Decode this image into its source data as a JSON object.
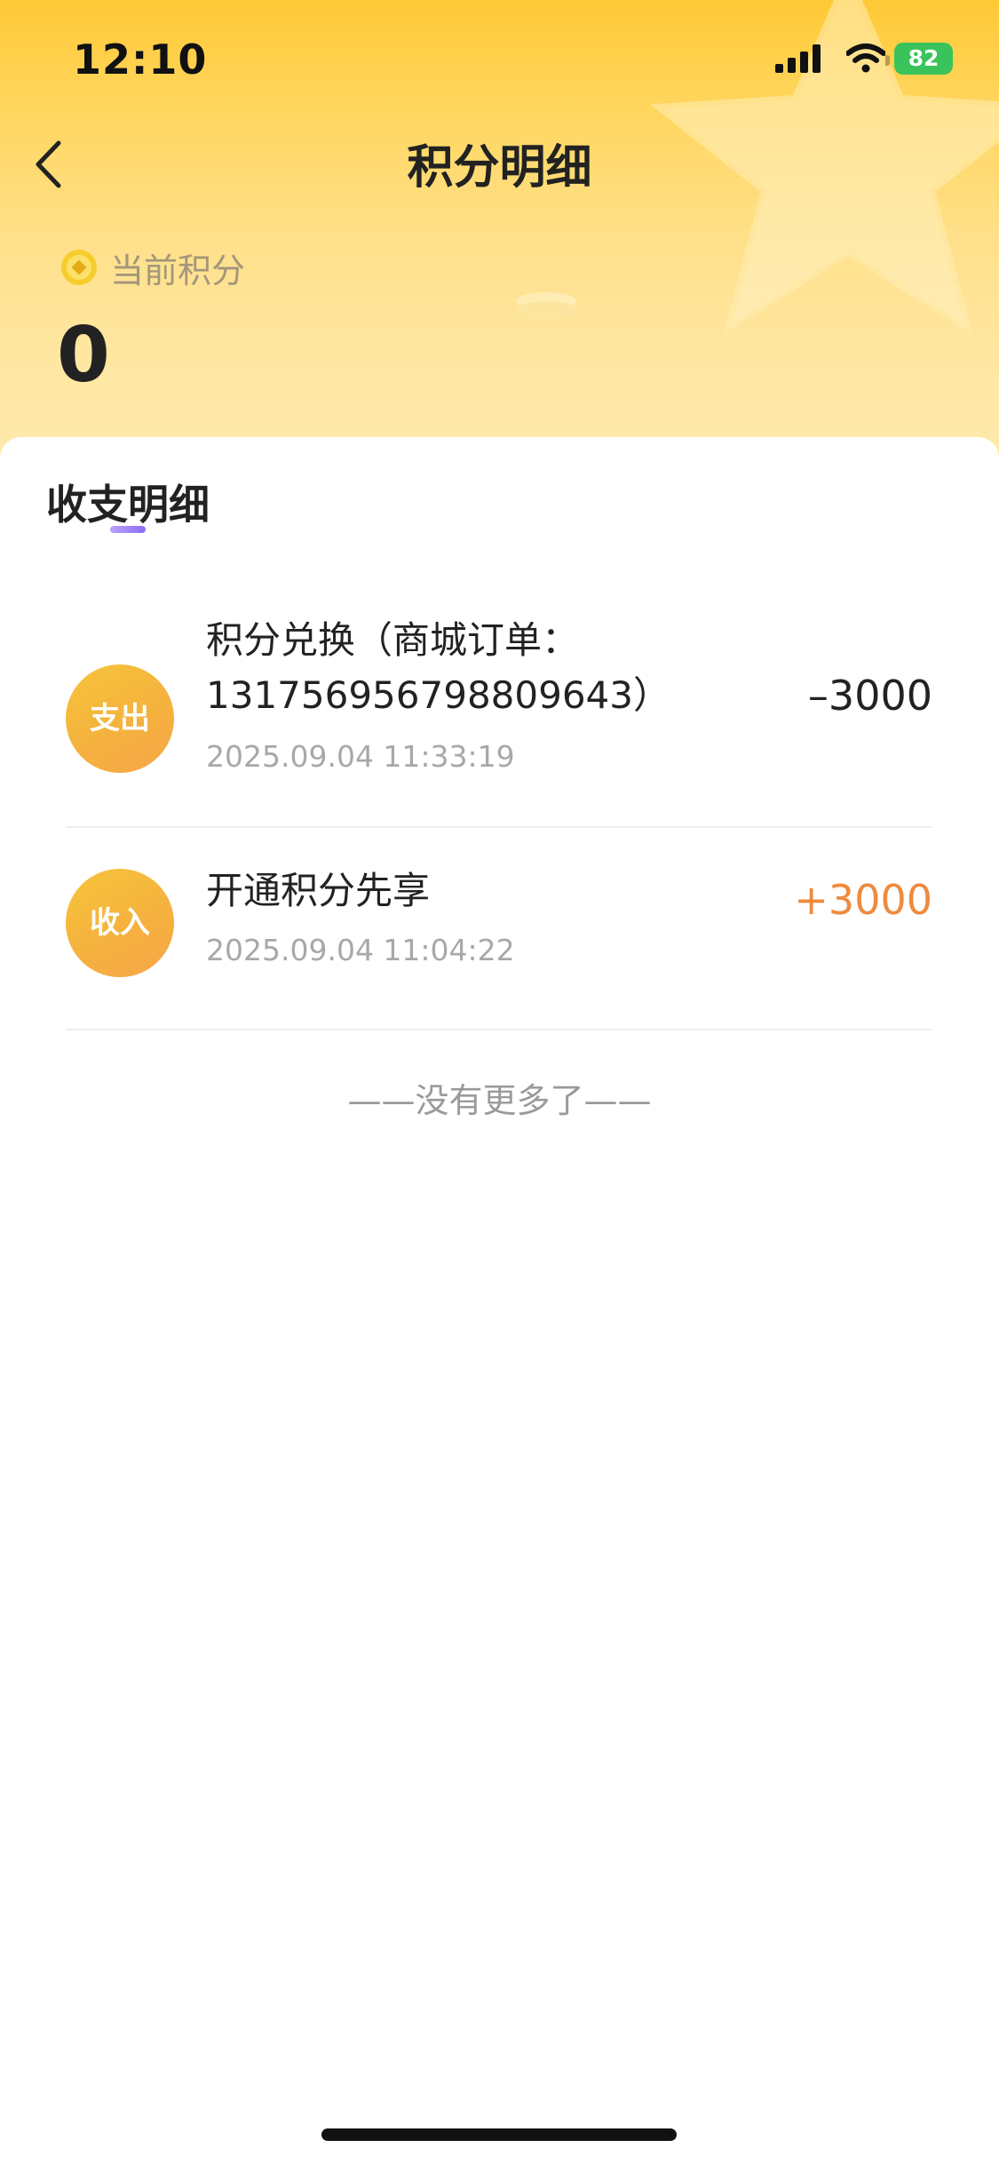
{
  "status_bar": {
    "time": "12:10",
    "battery": "82",
    "icons": [
      "cellular-signal-icon",
      "wifi-icon",
      "battery-charging-icon"
    ]
  },
  "nav": {
    "back_icon": "chevron-left-icon",
    "title": "积分明细"
  },
  "points": {
    "icon": "coin-icon",
    "label": "当前积分",
    "value": "0"
  },
  "section": {
    "tab_label": "收支明细"
  },
  "records": [
    {
      "badge": "支出",
      "title": "积分兑换（商城订单：1317569567988096​43）",
      "time": "2025.09.04 11:33:19",
      "amount": "–3000"
    },
    {
      "badge": "收入",
      "title": "开通积分先享",
      "time": "2025.09.04 11:04:22",
      "amount": "+3000"
    }
  ],
  "footer": {
    "no_more": "——没有更多了——"
  },
  "colors": {
    "header_gradient_top": "#ffc936",
    "header_gradient_bottom": "#ffeab0",
    "badge": "#f5b23e",
    "income_amount": "#ef8a3d",
    "tab_underline": "#8d6ef5"
  }
}
